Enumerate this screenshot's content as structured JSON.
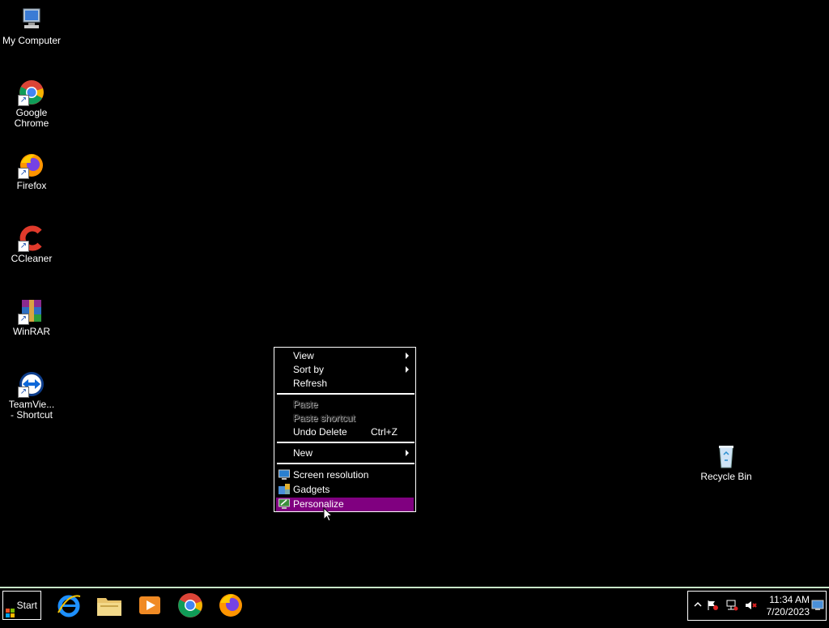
{
  "desktop": {
    "icons": [
      {
        "label": "My Computer"
      },
      {
        "label": "Google\nChrome"
      },
      {
        "label": "Firefox"
      },
      {
        "label": "CCleaner"
      },
      {
        "label": "WinRAR"
      },
      {
        "label": "TeamVie...\n- Shortcut"
      },
      {
        "label": "Recycle Bin"
      }
    ]
  },
  "context_menu": {
    "view": "View",
    "sort_by": "Sort by",
    "refresh": "Refresh",
    "paste": "Paste",
    "paste_shortcut": "Paste shortcut",
    "undo_delete": "Undo Delete",
    "undo_shortcut": "Ctrl+Z",
    "new": "New",
    "screen_resolution": "Screen resolution",
    "gadgets": "Gadgets",
    "personalize": "Personalize",
    "highlight_color": "#800080"
  },
  "taskbar": {
    "start_label": "Start",
    "pinned": [
      "internet-explorer-icon",
      "file-explorer-icon",
      "media-player-icon",
      "chrome-icon",
      "firefox-icon"
    ],
    "clock_time": "11:34 AM",
    "clock_date": "7/20/2023"
  }
}
